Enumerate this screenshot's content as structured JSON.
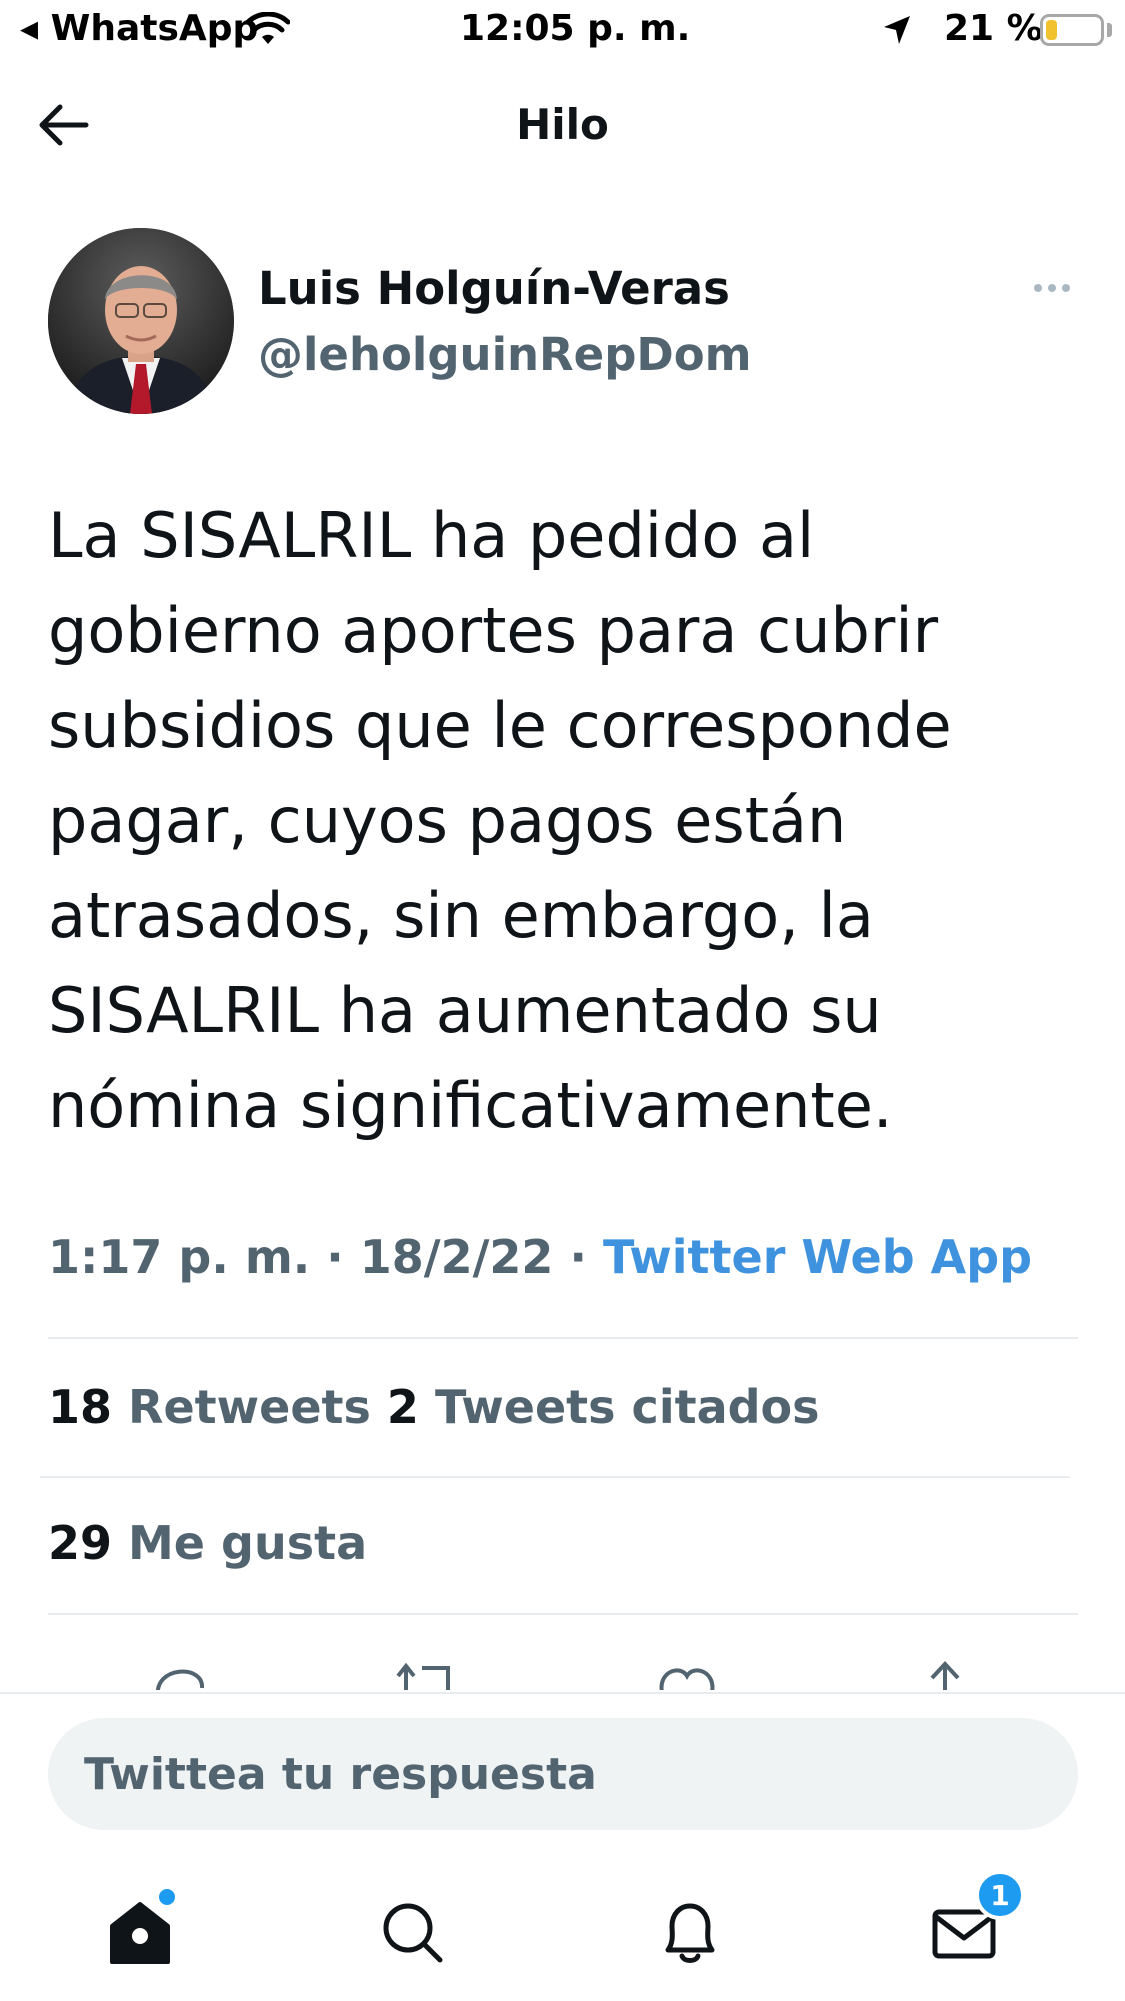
{
  "status_bar": {
    "back_app": "◂ WhatsApp",
    "time": "12:05 p. m.",
    "battery_pct": "21 %",
    "battery_level": 0.21
  },
  "nav": {
    "title": "Hilo"
  },
  "tweet": {
    "author_name": "Luis Holguín-Veras",
    "author_handle": "@leholguinRepDom",
    "text_lines": [
      "La SISALRIL ha pedido al",
      "gobierno aportes para cubrir",
      "subsidios que le corresponde",
      "pagar, cuyos pagos están",
      "atrasados, sin embargo, la",
      "SISALRIL ha aumentado su",
      "nómina significativamente."
    ],
    "time": "1:17 p. m.",
    "date": "18/2/22",
    "separator": "·",
    "source": "Twitter Web App"
  },
  "stats": {
    "retweets_count": "18",
    "retweets_label": "Retweets",
    "quotes_count": "2",
    "quotes_label": "Tweets citados",
    "likes_count": "29",
    "likes_label": "Me gusta"
  },
  "reply": {
    "placeholder": "Twittea tu respuesta"
  },
  "tab_bar": {
    "messages_badge": "1"
  },
  "colors": {
    "accent": "#1d9bf0",
    "link": "#3f93de",
    "secondary_text": "#536471"
  }
}
